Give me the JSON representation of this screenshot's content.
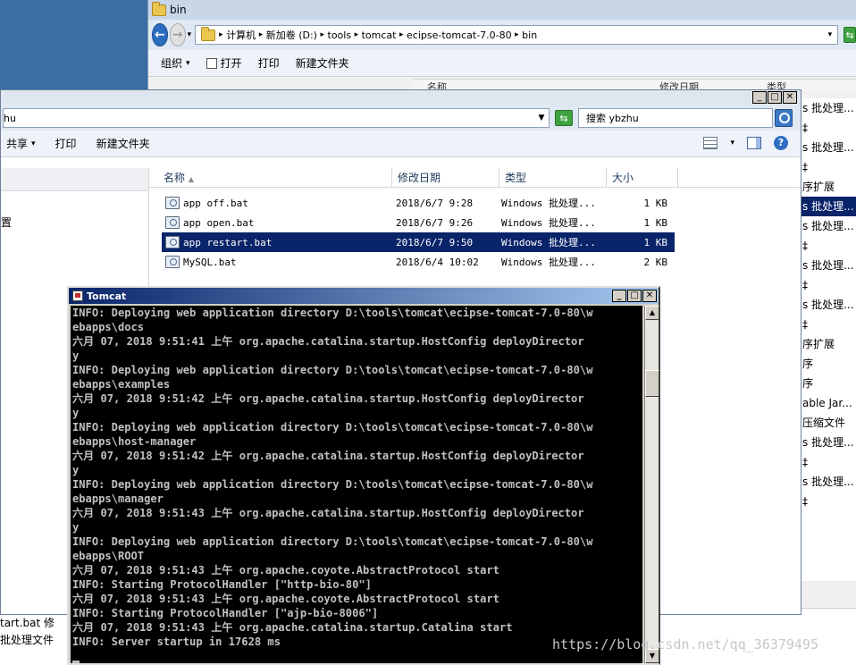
{
  "win1": {
    "title": "bin",
    "breadcrumb": [
      "计算机",
      "新加卷 (D:)",
      "tools",
      "tomcat",
      "ecipse-tomcat-7.0-80",
      "bin"
    ],
    "toolbar": {
      "organize": "组织",
      "open": "打开",
      "print": "打印",
      "new_folder": "新建文件夹"
    },
    "col_name": "名称",
    "col_date": "修改日期",
    "col_type": "类型",
    "right_list": [
      "s 批处理...",
      "‡",
      "s 批处理...",
      "‡",
      "序扩展",
      "s 批处理...",
      "s 批处理...",
      "‡",
      "s 批处理...",
      "‡",
      "s 批处理...",
      "‡",
      "序扩展",
      "序",
      "序",
      "able Jar...",
      " 压缩文件",
      "s 批处理...",
      "‡",
      "s 批处理...",
      "‡"
    ],
    "bottom_frag": [
      "tart.bat 修",
      "批处理文件"
    ]
  },
  "win2": {
    "address_tail": "hu",
    "search_placeholder": "搜索 ybzhu",
    "toolbar": {
      "share": "共享",
      "print": "打印",
      "new_folder": "新建文件夹"
    },
    "nav_item": "置",
    "columns": {
      "name": "名称",
      "date": "修改日期",
      "type": "类型",
      "size": "大小"
    },
    "files": [
      {
        "name": "app off.bat",
        "date": "2018/6/7 9:28",
        "type": "Windows 批处理...",
        "size": "1 KB",
        "selected": false
      },
      {
        "name": "app open.bat",
        "date": "2018/6/7 9:26",
        "type": "Windows 批处理...",
        "size": "1 KB",
        "selected": false
      },
      {
        "name": "app restart.bat",
        "date": "2018/6/7 9:50",
        "type": "Windows 批处理...",
        "size": "1 KB",
        "selected": true
      },
      {
        "name": "MySQL.bat",
        "date": "2018/6/4 10:02",
        "type": "Windows 批处理...",
        "size": "2 KB",
        "selected": false
      }
    ]
  },
  "console": {
    "title": "Tomcat",
    "lines": [
      "INFO: Deploying web application directory D:\\tools\\tomcat\\ecipse-tomcat-7.0-80\\w",
      "ebapps\\docs",
      "六月 07, 2018 9:51:41 上午 org.apache.catalina.startup.HostConfig deployDirector",
      "y",
      "INFO: Deploying web application directory D:\\tools\\tomcat\\ecipse-tomcat-7.0-80\\w",
      "ebapps\\examples",
      "六月 07, 2018 9:51:42 上午 org.apache.catalina.startup.HostConfig deployDirector",
      "y",
      "INFO: Deploying web application directory D:\\tools\\tomcat\\ecipse-tomcat-7.0-80\\w",
      "ebapps\\host-manager",
      "六月 07, 2018 9:51:42 上午 org.apache.catalina.startup.HostConfig deployDirector",
      "y",
      "INFO: Deploying web application directory D:\\tools\\tomcat\\ecipse-tomcat-7.0-80\\w",
      "ebapps\\manager",
      "六月 07, 2018 9:51:43 上午 org.apache.catalina.startup.HostConfig deployDirector",
      "y",
      "INFO: Deploying web application directory D:\\tools\\tomcat\\ecipse-tomcat-7.0-80\\w",
      "ebapps\\ROOT",
      "六月 07, 2018 9:51:43 上午 org.apache.coyote.AbstractProtocol start",
      "INFO: Starting ProtocolHandler [\"http-bio-80\"]",
      "六月 07, 2018 9:51:43 上午 org.apache.coyote.AbstractProtocol start",
      "INFO: Starting ProtocolHandler [\"ajp-bio-8006\"]",
      "六月 07, 2018 9:51:43 上午 org.apache.catalina.startup.Catalina start",
      "INFO: Server startup in 17628 ms"
    ]
  },
  "watermark": "https://blog.csdn.net/qq_36379495"
}
